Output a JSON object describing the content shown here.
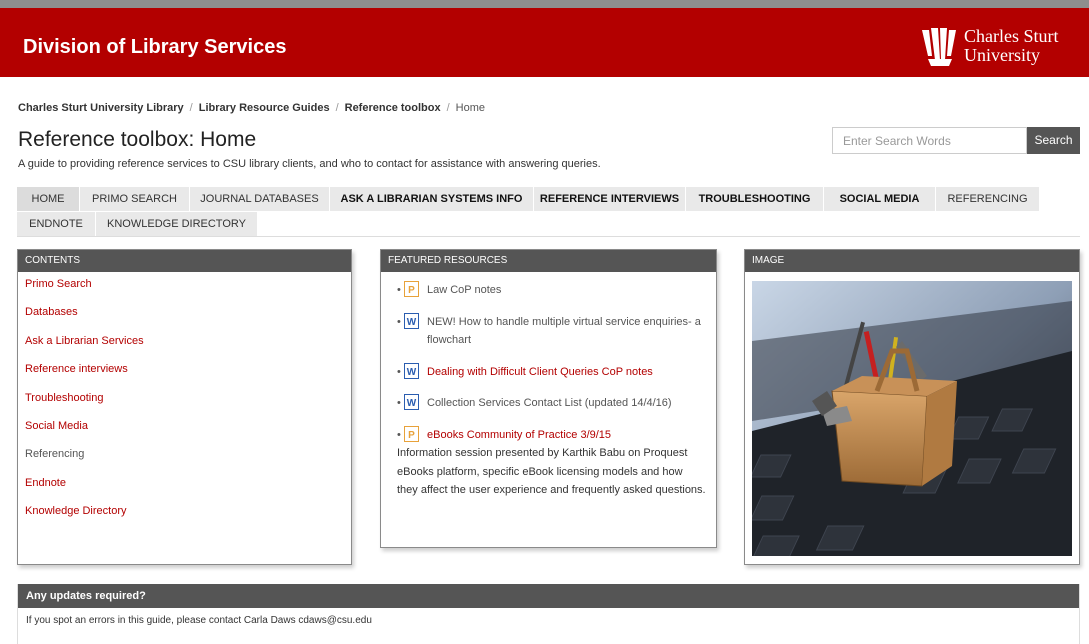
{
  "header": {
    "division_title": "Division of Library Services",
    "university_name_line1": "Charles Sturt",
    "university_name_line2": "University",
    "brand_color": "#b30000"
  },
  "breadcrumb": [
    "Charles Sturt University Library",
    "Library Resource Guides",
    "Reference toolbox",
    "Home"
  ],
  "page": {
    "title": "Reference toolbox: Home",
    "description": "A guide to providing reference services to CSU library clients, and who to contact for assistance with answering queries."
  },
  "search": {
    "placeholder": "Enter Search Words",
    "button_label": "Search"
  },
  "tabs": [
    "HOME",
    "PRIMO SEARCH",
    "JOURNAL DATABASES",
    "ASK A LIBRARIAN SYSTEMS INFO",
    "REFERENCE INTERVIEWS",
    "TROUBLESHOOTING",
    "SOCIAL MEDIA",
    "REFERENCING",
    "ENDNOTE",
    "KNOWLEDGE DIRECTORY"
  ],
  "contents": {
    "heading": "CONTENTS",
    "items": [
      "Primo Search",
      "Databases",
      "Ask a Librarian Services",
      "Reference interviews",
      "Troubleshooting",
      "Social Media",
      "Referencing",
      "Endnote",
      "Knowledge Directory"
    ]
  },
  "featured": {
    "heading": "FEATURED RESOURCES",
    "items": [
      {
        "label": "Law CoP notes",
        "icon": "powerpoint-file-icon"
      },
      {
        "label": "NEW! How to handle multiple virtual service enquiries- a flowchart",
        "icon": "word-file-icon"
      },
      {
        "label": "Dealing with Difficult Client Queries CoP notes",
        "icon": "word-file-icon"
      },
      {
        "label": "Collection Services Contact List (updated 14/4/16)",
        "icon": "word-file-icon"
      },
      {
        "label": "eBooks Community of Practice 3/9/15",
        "icon": "powerpoint-file-icon",
        "description": "Information session presented by Karthik Babu on Proquest eBooks platform, specific eBook licensing models and how they affect the user experience and frequently asked questions."
      }
    ]
  },
  "image_box": {
    "heading": "IMAGE"
  },
  "updates": {
    "heading": "Any updates required?",
    "text": "If you spot an errors in this guide, please contact Carla Daws cdaws@csu.edu"
  }
}
